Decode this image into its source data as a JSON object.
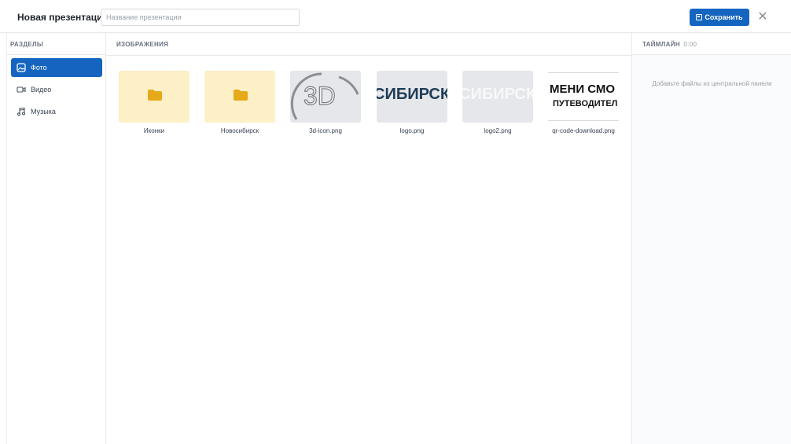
{
  "header": {
    "app_title": "Новая презентация",
    "title_placeholder": "Название презентации",
    "title_value": "",
    "save_label": "Сохранить",
    "close_glyph": "✕"
  },
  "sidebar": {
    "heading": "РАЗДЕЛЫ",
    "items": [
      {
        "label": "Фото",
        "icon": "image-icon",
        "active": true
      },
      {
        "label": "Видео",
        "icon": "video-icon",
        "active": false
      },
      {
        "label": "Музыка",
        "icon": "music-icon",
        "active": false
      }
    ]
  },
  "main": {
    "heading": "ИЗОБРАЖЕНИЯ",
    "files": [
      {
        "name": "Иконки",
        "kind": "folder"
      },
      {
        "name": "Новосибирск",
        "kind": "folder"
      },
      {
        "name": "3d-icon.png",
        "kind": "image",
        "preview_text": "3D"
      },
      {
        "name": "logo.png",
        "kind": "image",
        "preview_text": "СИБИРСК"
      },
      {
        "name": "logo2.png",
        "kind": "image",
        "preview_text": "СИБИРСК"
      },
      {
        "name": "qr-code-download.png",
        "kind": "image",
        "preview_text": "МЕНИ СМО",
        "preview_text_2": "ПУТЕВОДИТЕЛ"
      }
    ]
  },
  "timeline": {
    "heading": "ТАЙМЛАЙН",
    "time": "0:00",
    "empty_message": "Добавьте файлы из центральной панели"
  },
  "colors": {
    "accent": "#1565c0",
    "folder_bg": "#fdefc6",
    "folder_icon": "#e5a91a"
  }
}
